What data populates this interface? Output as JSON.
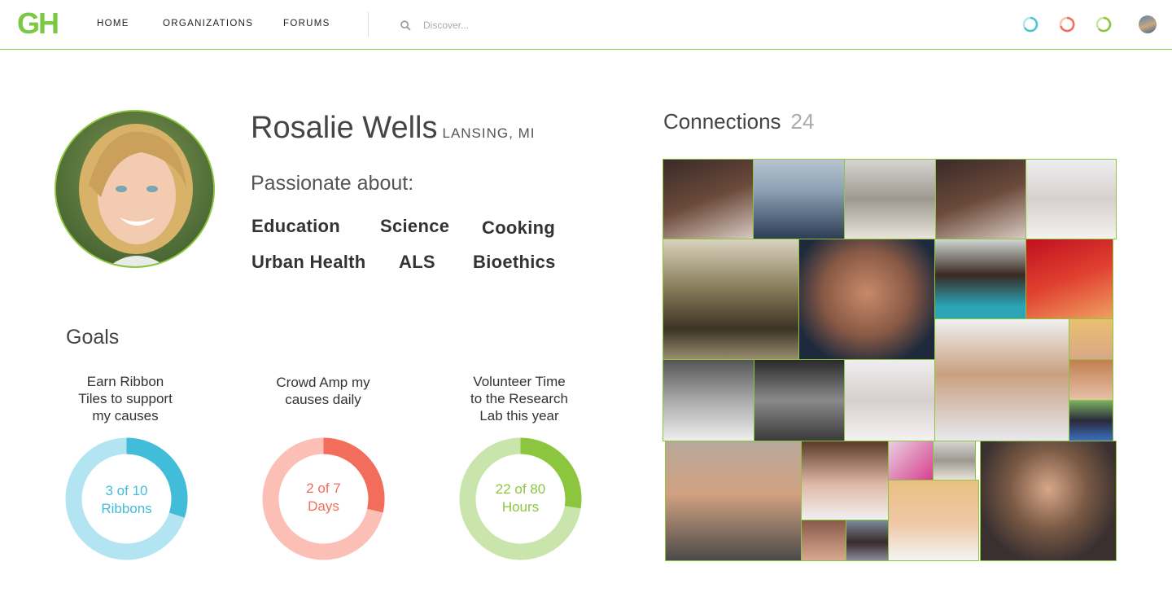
{
  "header": {
    "logo": "GH",
    "nav": [
      "HOME",
      "ORGANIZATIONS",
      "FORUMS"
    ],
    "search_placeholder": "Discover...",
    "status_icons": [
      {
        "name": "blue-ring-icon",
        "color": "#4fc1d9"
      },
      {
        "name": "red-ring-icon",
        "color": "#f26d5b"
      },
      {
        "name": "green-ring-icon",
        "color": "#8cc63f"
      }
    ]
  },
  "profile": {
    "name": "Rosalie Wells",
    "location": "LANSING, MI",
    "passion_heading": "Passionate about:",
    "passions": [
      "Education",
      "Science",
      "Cooking",
      "Urban Health",
      "ALS",
      "Bioethics"
    ]
  },
  "goals": {
    "title": "Goals",
    "items": [
      {
        "text": [
          "Earn Ribbon",
          "Tiles to support",
          "my causes"
        ],
        "value_line1": "3 of 10",
        "value_line2": "Ribbons",
        "current": 3,
        "target": 10,
        "color": "#42bdd9",
        "track_color": "#b3e4f1"
      },
      {
        "text": [
          "Crowd Amp my",
          "causes daily"
        ],
        "value_line1": "2 of 7",
        "value_line2": "Days",
        "current": 2,
        "target": 7,
        "color": "#f26d5b",
        "track_color": "#fbbfb5"
      },
      {
        "text": [
          "Volunteer Time",
          "to the Research",
          "Lab this year"
        ],
        "value_line1": "22 of 80",
        "value_line2": "Hours",
        "current": 22,
        "target": 80,
        "color": "#8cc63f",
        "track_color": "#c9e5ab"
      }
    ]
  },
  "connections": {
    "title": "Connections",
    "count": "24"
  },
  "colors": {
    "accent": "#8cc63f",
    "text": "#333333"
  }
}
